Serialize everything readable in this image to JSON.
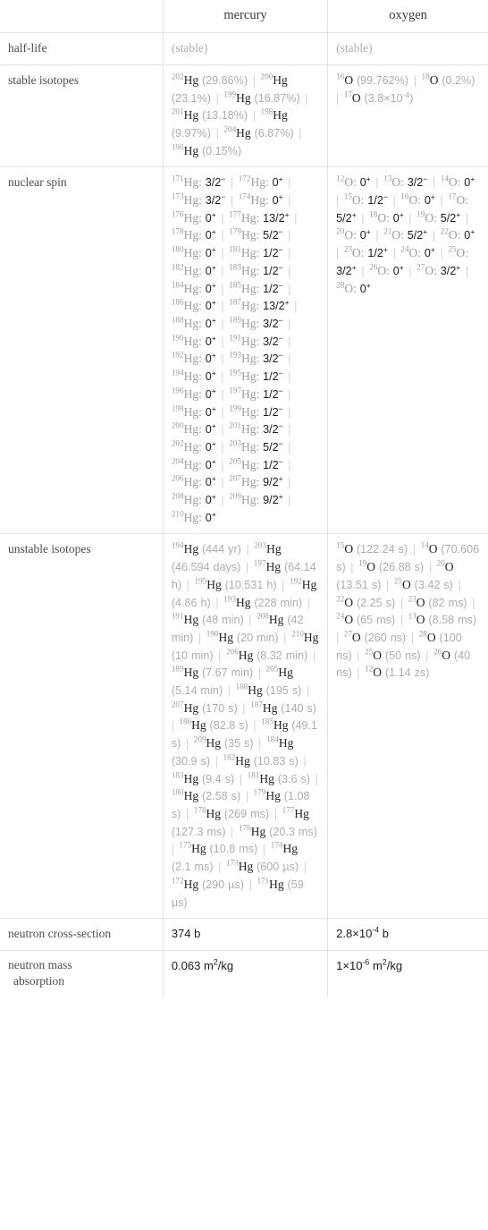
{
  "table": {
    "columns": [
      "",
      "mercury",
      "oxygen"
    ],
    "rows": [
      {
        "label": "half-life",
        "mercury": "(stable)",
        "oxygen": "(stable)"
      },
      {
        "label": "stable isotopes",
        "mercury_items": [
          {
            "mass": "202",
            "sym": "Hg",
            "value": "(29.86%)"
          },
          {
            "mass": "200",
            "sym": "Hg",
            "value": "(23.1%)"
          },
          {
            "mass": "199",
            "sym": "Hg",
            "value": "(16.87%)"
          },
          {
            "mass": "201",
            "sym": "Hg",
            "value": "(13.18%)"
          },
          {
            "mass": "198",
            "sym": "Hg",
            "value": "(9.97%)"
          },
          {
            "mass": "204",
            "sym": "Hg",
            "value": "(6.87%)"
          },
          {
            "mass": "196",
            "sym": "Hg",
            "value": "(0.15%)"
          }
        ],
        "oxygen_items": [
          {
            "mass": "16",
            "sym": "O",
            "value": "(99.762%)"
          },
          {
            "mass": "18",
            "sym": "O",
            "value": "(0.2%)"
          },
          {
            "mass": "17",
            "sym": "O",
            "value": "(3.8×10−4)",
            "value_base": "(3.8×10",
            "value_exp": "-4",
            "value_tail": ")"
          }
        ]
      },
      {
        "label": "nuclear spin",
        "mercury_items": [
          {
            "mass": "171",
            "sym": "Hg",
            "value": "3/2",
            "charge": "−"
          },
          {
            "mass": "172",
            "sym": "Hg",
            "value": "0",
            "charge": "+"
          },
          {
            "mass": "173",
            "sym": "Hg",
            "value": "3/2",
            "charge": "−"
          },
          {
            "mass": "174",
            "sym": "Hg",
            "value": "0",
            "charge": "+"
          },
          {
            "mass": "176",
            "sym": "Hg",
            "value": "0",
            "charge": "+"
          },
          {
            "mass": "177",
            "sym": "Hg",
            "value": "13/2",
            "charge": "+"
          },
          {
            "mass": "178",
            "sym": "Hg",
            "value": "0",
            "charge": "+"
          },
          {
            "mass": "179",
            "sym": "Hg",
            "value": "5/2",
            "charge": "−"
          },
          {
            "mass": "180",
            "sym": "Hg",
            "value": "0",
            "charge": "+"
          },
          {
            "mass": "181",
            "sym": "Hg",
            "value": "1/2",
            "charge": "−"
          },
          {
            "mass": "182",
            "sym": "Hg",
            "value": "0",
            "charge": "+"
          },
          {
            "mass": "183",
            "sym": "Hg",
            "value": "1/2",
            "charge": "−"
          },
          {
            "mass": "184",
            "sym": "Hg",
            "value": "0",
            "charge": "+"
          },
          {
            "mass": "185",
            "sym": "Hg",
            "value": "1/2",
            "charge": "−"
          },
          {
            "mass": "186",
            "sym": "Hg",
            "value": "0",
            "charge": "+"
          },
          {
            "mass": "187",
            "sym": "Hg",
            "value": "13/2",
            "charge": "+"
          },
          {
            "mass": "188",
            "sym": "Hg",
            "value": "0",
            "charge": "+"
          },
          {
            "mass": "189",
            "sym": "Hg",
            "value": "3/2",
            "charge": "−"
          },
          {
            "mass": "190",
            "sym": "Hg",
            "value": "0",
            "charge": "+"
          },
          {
            "mass": "191",
            "sym": "Hg",
            "value": "3/2",
            "charge": "−"
          },
          {
            "mass": "192",
            "sym": "Hg",
            "value": "0",
            "charge": "+"
          },
          {
            "mass": "193",
            "sym": "Hg",
            "value": "3/2",
            "charge": "−"
          },
          {
            "mass": "194",
            "sym": "Hg",
            "value": "0",
            "charge": "+"
          },
          {
            "mass": "195",
            "sym": "Hg",
            "value": "1/2",
            "charge": "−"
          },
          {
            "mass": "196",
            "sym": "Hg",
            "value": "0",
            "charge": "+"
          },
          {
            "mass": "197",
            "sym": "Hg",
            "value": "1/2",
            "charge": "−"
          },
          {
            "mass": "198",
            "sym": "Hg",
            "value": "0",
            "charge": "+"
          },
          {
            "mass": "199",
            "sym": "Hg",
            "value": "1/2",
            "charge": "−"
          },
          {
            "mass": "200",
            "sym": "Hg",
            "value": "0",
            "charge": "+"
          },
          {
            "mass": "201",
            "sym": "Hg",
            "value": "3/2",
            "charge": "−"
          },
          {
            "mass": "202",
            "sym": "Hg",
            "value": "0",
            "charge": "+"
          },
          {
            "mass": "203",
            "sym": "Hg",
            "value": "5/2",
            "charge": "−"
          },
          {
            "mass": "204",
            "sym": "Hg",
            "value": "0",
            "charge": "+"
          },
          {
            "mass": "205",
            "sym": "Hg",
            "value": "1/2",
            "charge": "−"
          },
          {
            "mass": "206",
            "sym": "Hg",
            "value": "0",
            "charge": "+"
          },
          {
            "mass": "207",
            "sym": "Hg",
            "value": "9/2",
            "charge": "+"
          },
          {
            "mass": "208",
            "sym": "Hg",
            "value": "0",
            "charge": "+"
          },
          {
            "mass": "209",
            "sym": "Hg",
            "value": "9/2",
            "charge": "+"
          },
          {
            "mass": "210",
            "sym": "Hg",
            "value": "0",
            "charge": "+"
          }
        ],
        "oxygen_items": [
          {
            "mass": "12",
            "sym": "O",
            "value": "0",
            "charge": "+"
          },
          {
            "mass": "13",
            "sym": "O",
            "value": "3/2",
            "charge": "−"
          },
          {
            "mass": "14",
            "sym": "O",
            "value": "0",
            "charge": "+"
          },
          {
            "mass": "15",
            "sym": "O",
            "value": "1/2",
            "charge": "−"
          },
          {
            "mass": "16",
            "sym": "O",
            "value": "0",
            "charge": "+"
          },
          {
            "mass": "17",
            "sym": "O",
            "value": "5/2",
            "charge": "+"
          },
          {
            "mass": "18",
            "sym": "O",
            "value": "0",
            "charge": "+"
          },
          {
            "mass": "19",
            "sym": "O",
            "value": "5/2",
            "charge": "+"
          },
          {
            "mass": "20",
            "sym": "O",
            "value": "0",
            "charge": "+"
          },
          {
            "mass": "21",
            "sym": "O",
            "value": "5/2",
            "charge": "+"
          },
          {
            "mass": "22",
            "sym": "O",
            "value": "0",
            "charge": "+"
          },
          {
            "mass": "23",
            "sym": "O",
            "value": "1/2",
            "charge": "+"
          },
          {
            "mass": "24",
            "sym": "O",
            "value": "0",
            "charge": "+"
          },
          {
            "mass": "25",
            "sym": "O",
            "value": "3/2",
            "charge": "+"
          },
          {
            "mass": "26",
            "sym": "O",
            "value": "0",
            "charge": "+"
          },
          {
            "mass": "27",
            "sym": "O",
            "value": "3/2",
            "charge": "+"
          },
          {
            "mass": "28",
            "sym": "O",
            "value": "0",
            "charge": "+"
          }
        ]
      },
      {
        "label": "unstable isotopes",
        "mercury_items": [
          {
            "mass": "194",
            "sym": "Hg",
            "value": "(444 yr)"
          },
          {
            "mass": "203",
            "sym": "Hg",
            "value": "(46.594 days)"
          },
          {
            "mass": "197",
            "sym": "Hg",
            "value": "(64.14 h)"
          },
          {
            "mass": "195",
            "sym": "Hg",
            "value": "(10.531 h)"
          },
          {
            "mass": "192",
            "sym": "Hg",
            "value": "(4.86 h)"
          },
          {
            "mass": "193",
            "sym": "Hg",
            "value": "(228 min)"
          },
          {
            "mass": "191",
            "sym": "Hg",
            "value": "(48 min)"
          },
          {
            "mass": "208",
            "sym": "Hg",
            "value": "(42 min)"
          },
          {
            "mass": "190",
            "sym": "Hg",
            "value": "(20 min)"
          },
          {
            "mass": "210",
            "sym": "Hg",
            "value": "(10 min)"
          },
          {
            "mass": "206",
            "sym": "Hg",
            "value": "(8.32 min)"
          },
          {
            "mass": "189",
            "sym": "Hg",
            "value": "(7.67 min)"
          },
          {
            "mass": "205",
            "sym": "Hg",
            "value": "(5.14 min)"
          },
          {
            "mass": "188",
            "sym": "Hg",
            "value": "(195 s)"
          },
          {
            "mass": "207",
            "sym": "Hg",
            "value": "(170 s)"
          },
          {
            "mass": "187",
            "sym": "Hg",
            "value": "(140 s)"
          },
          {
            "mass": "186",
            "sym": "Hg",
            "value": "(82.8 s)"
          },
          {
            "mass": "185",
            "sym": "Hg",
            "value": "(49.1 s)"
          },
          {
            "mass": "209",
            "sym": "Hg",
            "value": "(35 s)"
          },
          {
            "mass": "184",
            "sym": "Hg",
            "value": "(30.9 s)"
          },
          {
            "mass": "182",
            "sym": "Hg",
            "value": "(10.83 s)"
          },
          {
            "mass": "183",
            "sym": "Hg",
            "value": "(9.4 s)"
          },
          {
            "mass": "181",
            "sym": "Hg",
            "value": "(3.6 s)"
          },
          {
            "mass": "180",
            "sym": "Hg",
            "value": "(2.58 s)"
          },
          {
            "mass": "179",
            "sym": "Hg",
            "value": "(1.08 s)"
          },
          {
            "mass": "178",
            "sym": "Hg",
            "value": "(269 ms)"
          },
          {
            "mass": "177",
            "sym": "Hg",
            "value": "(127.3 ms)"
          },
          {
            "mass": "176",
            "sym": "Hg",
            "value": "(20.3 ms)"
          },
          {
            "mass": "175",
            "sym": "Hg",
            "value": "(10.8 ms)"
          },
          {
            "mass": "174",
            "sym": "Hg",
            "value": "(2.1 ms)"
          },
          {
            "mass": "173",
            "sym": "Hg",
            "value": "(600 µs)"
          },
          {
            "mass": "172",
            "sym": "Hg",
            "value": "(290 µs)"
          },
          {
            "mass": "171",
            "sym": "Hg",
            "value": "(59 µs)"
          }
        ],
        "oxygen_items": [
          {
            "mass": "15",
            "sym": "O",
            "value": "(122.24 s)"
          },
          {
            "mass": "14",
            "sym": "O",
            "value": "(70.606 s)"
          },
          {
            "mass": "19",
            "sym": "O",
            "value": "(26.88 s)"
          },
          {
            "mass": "20",
            "sym": "O",
            "value": "(13.51 s)"
          },
          {
            "mass": "21",
            "sym": "O",
            "value": "(3.42 s)"
          },
          {
            "mass": "22",
            "sym": "O",
            "value": "(2.25 s)"
          },
          {
            "mass": "23",
            "sym": "O",
            "value": "(82 ms)"
          },
          {
            "mass": "24",
            "sym": "O",
            "value": "(65 ms)"
          },
          {
            "mass": "13",
            "sym": "O",
            "value": "(8.58 ms)"
          },
          {
            "mass": "27",
            "sym": "O",
            "value": "(260 ns)"
          },
          {
            "mass": "28",
            "sym": "O",
            "value": "(100 ns)"
          },
          {
            "mass": "25",
            "sym": "O",
            "value": "(50 ns)"
          },
          {
            "mass": "26",
            "sym": "O",
            "value": "(40 ns)"
          },
          {
            "mass": "12",
            "sym": "O",
            "value": "(1.14 zs)"
          }
        ]
      },
      {
        "label": "neutron cross-section",
        "mercury": "374 b",
        "oxygen_base": "2.8×10",
        "oxygen_exp": "-4",
        "oxygen_tail": " b",
        "oxygen": "2.8×10−4 b"
      },
      {
        "label": "neutron mass absorption",
        "label_line1": "neutron mass",
        "label_line2": "absorption",
        "mercury_base": "0.063 m",
        "mercury_exp": "2",
        "mercury_tail": "/kg",
        "mercury": "0.063 m2/kg",
        "oxygen_base": "1×10",
        "oxygen_exp": "-6",
        "oxygen_tail2": " m",
        "oxygen_exp2": "2",
        "oxygen_tail": "/kg",
        "oxygen": "1×10−6 m2/kg"
      }
    ]
  },
  "colors": {
    "border": "#e4e4e4",
    "muted": "#b0b0b0",
    "text": "#3b3b3b",
    "value": "#242424"
  }
}
